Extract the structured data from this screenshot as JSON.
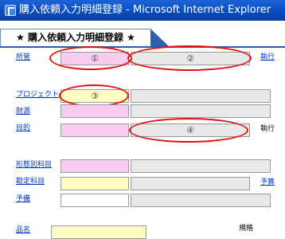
{
  "window": {
    "title": "購入依頼入力明細登録 - Microsoft Internet Explorer"
  },
  "page": {
    "heading": "★ 購入依頼入力明細登録 ★"
  },
  "labels": {
    "shozoku": "所管",
    "project": "プロジェクト",
    "zaigen": "財源",
    "mokuteki": "目的",
    "keitaibetsu": "形態別科目",
    "kanjo": "勘定科目",
    "yosan": "予備",
    "hinmei": "品名"
  },
  "right_labels": {
    "shikko1": "執行",
    "shikko2": "執行",
    "yosan": "予算",
    "kikaku": "規格"
  },
  "markers": {
    "m1": "①",
    "m2": "②",
    "m3": "③",
    "m4": "④"
  },
  "colors": {
    "titlebar": "#0a4fc4",
    "link": "#0033cc",
    "highlight_ellipse": "#e01010",
    "pink_field": "#f8ccf0",
    "yellow_field": "#fffdc4",
    "gray_field": "#e8e8e8"
  }
}
